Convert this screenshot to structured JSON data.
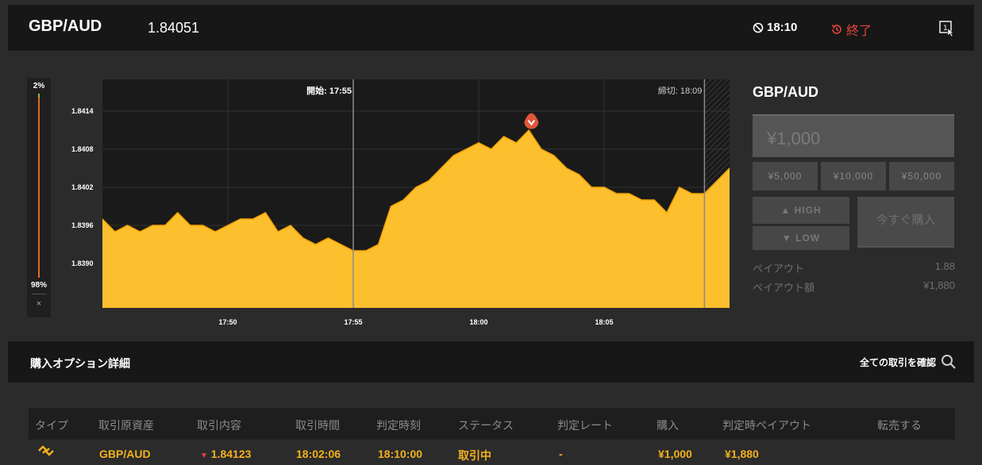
{
  "header": {
    "pair": "GBP/AUD",
    "rate": "1.84051",
    "timer_icon": "no-entry-circle-icon",
    "timer": "18:10",
    "ended_icon": "history-icon",
    "ended_label": "終了",
    "expand_icon": "cursor-window-icon"
  },
  "sentiment": {
    "high_pct": "2%",
    "low_pct": "98%",
    "close_label": "×",
    "high_fraction": 0.02,
    "low_fraction": 0.98
  },
  "chart_data": {
    "type": "area",
    "title": "",
    "xlabel": "",
    "ylabel": "",
    "x_ticks": [
      "17:50",
      "17:55",
      "18:00",
      "18:05"
    ],
    "y_ticks": [
      "1.8414",
      "1.8408",
      "1.8402",
      "1.8396",
      "1.8390"
    ],
    "xlim": [
      "17:45",
      "18:10"
    ],
    "ylim": [
      1.8383,
      1.8419
    ],
    "start_label": "開始: 17:55",
    "end_label": "締切: 18:09",
    "entry_marker": {
      "time": "18:02:06",
      "value": 1.84123,
      "direction": "low"
    },
    "colors": {
      "area": "#fcc02e",
      "line": "#f2a100",
      "marker": "#e0553a"
    },
    "series": [
      {
        "x": [
          "17:45:00",
          "17:45:30",
          "17:46:00",
          "17:46:30",
          "17:47:00",
          "17:47:30",
          "17:48:00",
          "17:48:30",
          "17:49:00",
          "17:49:30",
          "17:50:00",
          "17:50:30",
          "17:51:00",
          "17:51:30",
          "17:52:00",
          "17:52:30",
          "17:53:00",
          "17:53:30",
          "17:54:00",
          "17:54:30",
          "17:55:00",
          "17:55:30",
          "17:56:00",
          "17:56:30",
          "17:57:00",
          "17:57:30",
          "17:58:00",
          "17:58:30",
          "17:59:00",
          "17:59:30",
          "18:00:00",
          "18:00:30",
          "18:01:00",
          "18:01:30",
          "18:02:00",
          "18:02:30",
          "18:03:00",
          "18:03:30",
          "18:04:00",
          "18:04:30",
          "18:05:00",
          "18:05:30",
          "18:06:00",
          "18:06:30",
          "18:07:00",
          "18:07:30",
          "18:08:00",
          "18:08:30",
          "18:09:00",
          "18:09:30",
          "18:10:00"
        ],
        "values": [
          1.8397,
          1.8395,
          1.8396,
          1.8395,
          1.8396,
          1.8396,
          1.8398,
          1.8396,
          1.8396,
          1.8395,
          1.8396,
          1.8397,
          1.8397,
          1.8398,
          1.8395,
          1.8396,
          1.8394,
          1.8393,
          1.8394,
          1.8393,
          1.8392,
          1.8392,
          1.8393,
          1.8399,
          1.84,
          1.8402,
          1.8403,
          1.8405,
          1.8407,
          1.8408,
          1.8409,
          1.8408,
          1.841,
          1.8409,
          1.8411,
          1.8408,
          1.8407,
          1.8405,
          1.8404,
          1.8402,
          1.8402,
          1.8401,
          1.8401,
          1.84,
          1.84,
          1.8398,
          1.8402,
          1.8401,
          1.8401,
          1.8403,
          1.8405
        ]
      }
    ]
  },
  "trade": {
    "title": "GBP/AUD",
    "amount": "¥1,000",
    "quick": [
      "¥5,000",
      "¥10,000",
      "¥50,000"
    ],
    "high_label": "HIGH",
    "low_label": "LOW",
    "buy_now": "今すぐ購入",
    "payout_label": "ペイアウト",
    "payout_value": "1.88",
    "payout_amount_label": "ペイアウト額",
    "payout_amount_value": "¥1,880"
  },
  "details": {
    "title": "購入オプション詳細",
    "all_trades": "全ての取引を確認",
    "columns": [
      "タイプ",
      "取引原資産",
      "取引内容",
      "取引時間",
      "判定時刻",
      "ステータス",
      "判定レート",
      "購入",
      "判定時ペイアウト",
      "転売する"
    ],
    "row": {
      "type_icon": "spread-icon",
      "asset": "GBP/AUD",
      "direction_icon": "low-arrow-icon",
      "strike": "1.84123",
      "trade_time": "18:02:06",
      "expiry": "18:10:00",
      "status": "取引中",
      "closing_rate": "-",
      "purchase": "¥1,000",
      "payout": "¥1,880"
    }
  }
}
